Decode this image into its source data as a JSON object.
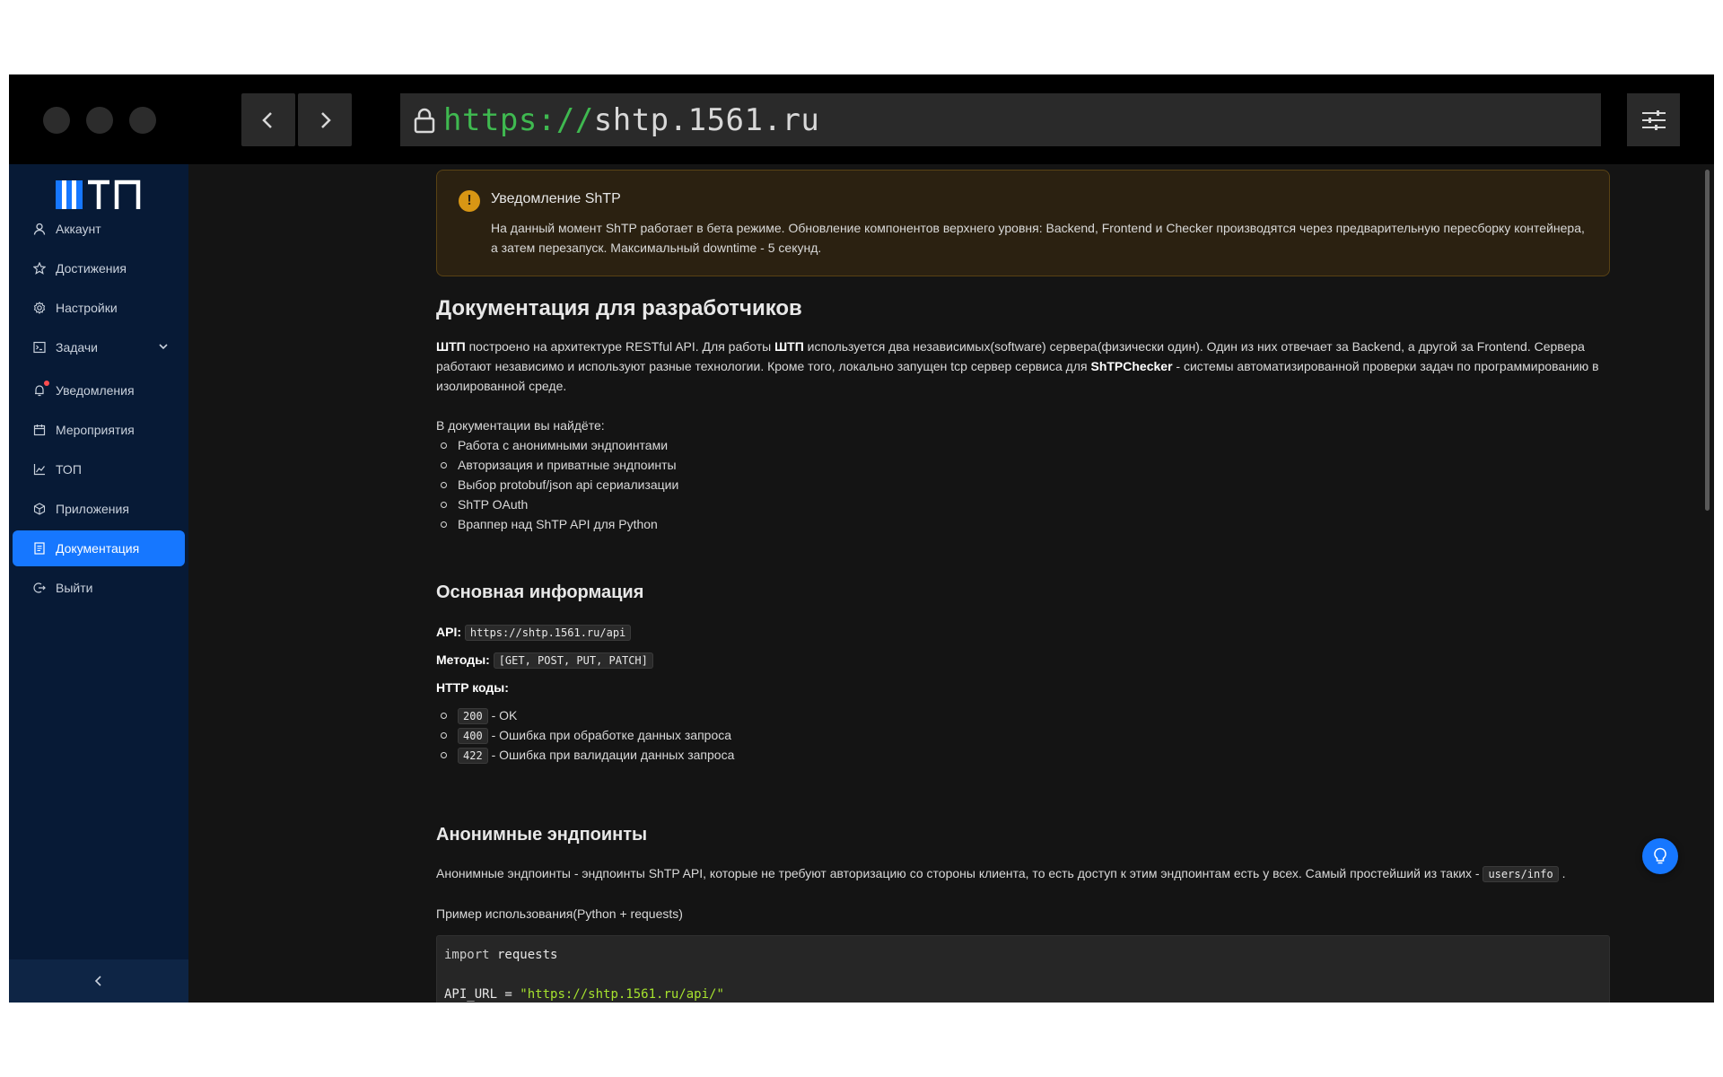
{
  "browser": {
    "url_scheme": "https://",
    "url_host": "shtp.1561.ru"
  },
  "sidebar": {
    "logo_text": "ШТП",
    "items": [
      {
        "label": "Аккаунт",
        "icon": "user-icon"
      },
      {
        "label": "Достижения",
        "icon": "star-icon"
      },
      {
        "label": "Настройки",
        "icon": "gear-icon"
      },
      {
        "label": "Задачи",
        "icon": "terminal-icon"
      },
      {
        "label": "Уведомления",
        "icon": "bell-icon"
      },
      {
        "label": "Мероприятия",
        "icon": "calendar-icon"
      },
      {
        "label": "ТОП",
        "icon": "chart-line-icon"
      },
      {
        "label": "Приложения",
        "icon": "cube-icon"
      },
      {
        "label": "Документация",
        "icon": "document-icon",
        "active": true
      },
      {
        "label": "Выйти",
        "icon": "logout-icon"
      }
    ],
    "accent_color": "#1677ff",
    "background_color": "#071a36"
  },
  "alert": {
    "title": "Уведомление ShTP",
    "description": "На данный момент ShTP работает в бета режиме. Обновление компонентов верхнего уровня: Backend, Frontend и Checker производятся через предварительную пересборку контейнера, а затем перезапуск. Максимальный downtime - 5 секунд."
  },
  "doc": {
    "title": "Документация для разработчиков",
    "intro": {
      "b1": "ШТП",
      "t1": " построено на архитектуре RESTful API. Для работы ",
      "b2": "ШТП",
      "t2": " используется два независимых(software) сервера(физически один). Один из них отвечает за Backend, а другой за Frontend. Сервера работают независимо и используют разные технологии. Кроме того, локально запущен tcp сервер сервиса для ",
      "b3": "ShTPChecker",
      "t3": " - системы автоматизированной проверки задач по программированию в изолированной среде."
    },
    "toc_heading": "В документации вы найдёте:",
    "toc": [
      "Работа с анонимными эндпоинтами",
      "Авторизация и приватные эндпоинты",
      "Выбор protobuf/json api сериализации",
      "ShTP OAuth",
      "Враппер над ShTP API для Python"
    ],
    "basic": {
      "title": "Основная информация",
      "api_label": "API:",
      "api_value": "https://shtp.1561.ru/api",
      "methods_label": "Методы:",
      "methods_value": "[GET, POST, PUT, PATCH]",
      "http_label": "HTTP коды:",
      "codes": [
        {
          "code": "200",
          "text": " - OK",
          "color": "#52c41a"
        },
        {
          "code": "400",
          "text": " - Ошибка при обработке данных запроса",
          "color": "#d89614"
        },
        {
          "code": "422",
          "text": " - Ошибка при валидации данных запроса",
          "color": "#ff4d4f"
        }
      ]
    },
    "anon": {
      "title": "Анонимные эндпоинты",
      "text": "Анонимные эндпоинты - эндпоинты ShTP API, которые не требуют авторизацию со стороны клиента, то есть доступ к этим эндпоинтам есть у всех. Самый простейший из таких - ",
      "endpoint": "users/info",
      "text_end": ".",
      "example_label": "Пример использования(Python + requests)",
      "code_line1_kw": "import",
      "code_line1_rest": " requests",
      "code_line2_var": "API_URL = ",
      "code_line2_str": "\"https://shtp.1561.ru/api/\""
    }
  }
}
